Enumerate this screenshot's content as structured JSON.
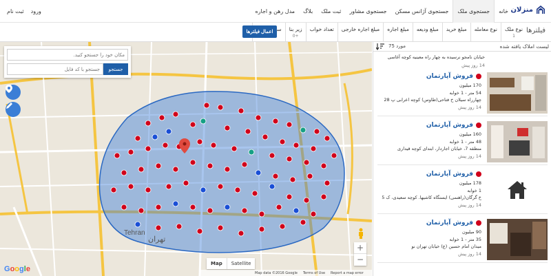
{
  "nav": {
    "brand": "منزلان",
    "menu": [
      "خانه",
      "جستجوی ملک",
      "جستجوی آژانس مسکن",
      "جستجوی مشاور",
      "ثبت ملک",
      "بلاگ",
      "مدل رهن و اجاره"
    ],
    "active_index": 1,
    "login": "ورود",
    "register": "ثبت نام"
  },
  "filters": {
    "title": "فیلترها",
    "tabs": [
      {
        "label": "نوع ملک",
        "count": "1"
      },
      {
        "label": "نوع معامله",
        "count": ""
      },
      {
        "label": "مبلغ خرید",
        "count": ""
      },
      {
        "label": "مبلغ ودیعه",
        "count": ""
      },
      {
        "label": "مبلغ اجاره",
        "count": ""
      },
      {
        "label": "مبلغ اجاره خارجی",
        "count": ""
      },
      {
        "label": "تعداد خواب",
        "count": ""
      },
      {
        "label": "زیر بنا",
        "count": "0+"
      },
      {
        "label": "سال ساخت",
        "count": ""
      }
    ],
    "send_button": "اعمال فیلترها"
  },
  "map": {
    "search_placeholder": "مکان خود را جستجو کنید.",
    "code_placeholder": "جستجو با کد فایل",
    "search_button": "جستجو",
    "map_types": [
      "Map",
      "Satellite"
    ],
    "zoom_in": "+",
    "zoom_out": "−",
    "city_label_fa": "تهران",
    "city_label_en": "Tehran",
    "footer": [
      "Map data ©2016 Google",
      "Terms of Use",
      "Report a map error"
    ],
    "colors": {
      "polygon": "#3d7fd9",
      "marker_red": "#d0021b",
      "marker_blue": "#1a4fd6",
      "marker_green": "#16a085",
      "pin": "#e04a3f"
    }
  },
  "results": {
    "title": "لیست املاک یافته شده",
    "count": "75 مورد",
    "top_partial": {
      "address": "خیابان نامجو نرسیده به چهار راه معینیه کوچه آغاسی",
      "time": "14 روز پیش"
    },
    "items": [
      {
        "title": "فروش آپارتمان",
        "price": "170 میلیون",
        "specs": "54 متر - 1 خوابه",
        "address": "چهارراه سیلان خ فتاحی(طاوس) کوچه اعرابی پ 28",
        "time": "14 روز پیش"
      },
      {
        "title": "فروش آپارتمان",
        "price": "160 میلیون",
        "specs": "48 متر - 1 خوابه",
        "address": "منطقه 7، خیابان اجاردار، ابتدای کوچه قیداری",
        "time": "14 روز پیش"
      },
      {
        "title": "فروش آپارتمان",
        "price": "178 میلیون",
        "specs": "1 خوابه",
        "address": "خ گرگان(راهنمی) ایستگاه کاشیها. کوچه سعیدی، ک 5",
        "time": "14 روز پیش"
      },
      {
        "title": "فروش آپارتمان",
        "price": "90 میلیون",
        "specs": "35 متر - 1 خوابه",
        "address": "میدان امام حسین (ع) خیابان تهران نو",
        "time": "14 روز پیش"
      }
    ]
  }
}
